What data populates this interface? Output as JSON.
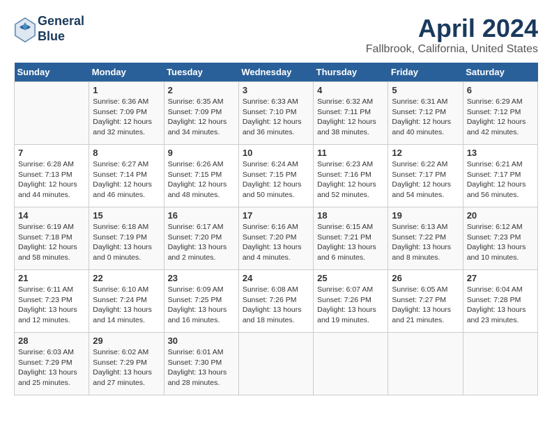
{
  "header": {
    "logo_line1": "General",
    "logo_line2": "Blue",
    "title": "April 2024",
    "subtitle": "Fallbrook, California, United States"
  },
  "days_of_week": [
    "Sunday",
    "Monday",
    "Tuesday",
    "Wednesday",
    "Thursday",
    "Friday",
    "Saturday"
  ],
  "weeks": [
    [
      {
        "day": "",
        "sunrise": "",
        "sunset": "",
        "daylight": ""
      },
      {
        "day": "1",
        "sunrise": "Sunrise: 6:36 AM",
        "sunset": "Sunset: 7:09 PM",
        "daylight": "Daylight: 12 hours and 32 minutes."
      },
      {
        "day": "2",
        "sunrise": "Sunrise: 6:35 AM",
        "sunset": "Sunset: 7:09 PM",
        "daylight": "Daylight: 12 hours and 34 minutes."
      },
      {
        "day": "3",
        "sunrise": "Sunrise: 6:33 AM",
        "sunset": "Sunset: 7:10 PM",
        "daylight": "Daylight: 12 hours and 36 minutes."
      },
      {
        "day": "4",
        "sunrise": "Sunrise: 6:32 AM",
        "sunset": "Sunset: 7:11 PM",
        "daylight": "Daylight: 12 hours and 38 minutes."
      },
      {
        "day": "5",
        "sunrise": "Sunrise: 6:31 AM",
        "sunset": "Sunset: 7:12 PM",
        "daylight": "Daylight: 12 hours and 40 minutes."
      },
      {
        "day": "6",
        "sunrise": "Sunrise: 6:29 AM",
        "sunset": "Sunset: 7:12 PM",
        "daylight": "Daylight: 12 hours and 42 minutes."
      }
    ],
    [
      {
        "day": "7",
        "sunrise": "Sunrise: 6:28 AM",
        "sunset": "Sunset: 7:13 PM",
        "daylight": "Daylight: 12 hours and 44 minutes."
      },
      {
        "day": "8",
        "sunrise": "Sunrise: 6:27 AM",
        "sunset": "Sunset: 7:14 PM",
        "daylight": "Daylight: 12 hours and 46 minutes."
      },
      {
        "day": "9",
        "sunrise": "Sunrise: 6:26 AM",
        "sunset": "Sunset: 7:15 PM",
        "daylight": "Daylight: 12 hours and 48 minutes."
      },
      {
        "day": "10",
        "sunrise": "Sunrise: 6:24 AM",
        "sunset": "Sunset: 7:15 PM",
        "daylight": "Daylight: 12 hours and 50 minutes."
      },
      {
        "day": "11",
        "sunrise": "Sunrise: 6:23 AM",
        "sunset": "Sunset: 7:16 PM",
        "daylight": "Daylight: 12 hours and 52 minutes."
      },
      {
        "day": "12",
        "sunrise": "Sunrise: 6:22 AM",
        "sunset": "Sunset: 7:17 PM",
        "daylight": "Daylight: 12 hours and 54 minutes."
      },
      {
        "day": "13",
        "sunrise": "Sunrise: 6:21 AM",
        "sunset": "Sunset: 7:17 PM",
        "daylight": "Daylight: 12 hours and 56 minutes."
      }
    ],
    [
      {
        "day": "14",
        "sunrise": "Sunrise: 6:19 AM",
        "sunset": "Sunset: 7:18 PM",
        "daylight": "Daylight: 12 hours and 58 minutes."
      },
      {
        "day": "15",
        "sunrise": "Sunrise: 6:18 AM",
        "sunset": "Sunset: 7:19 PM",
        "daylight": "Daylight: 13 hours and 0 minutes."
      },
      {
        "day": "16",
        "sunrise": "Sunrise: 6:17 AM",
        "sunset": "Sunset: 7:20 PM",
        "daylight": "Daylight: 13 hours and 2 minutes."
      },
      {
        "day": "17",
        "sunrise": "Sunrise: 6:16 AM",
        "sunset": "Sunset: 7:20 PM",
        "daylight": "Daylight: 13 hours and 4 minutes."
      },
      {
        "day": "18",
        "sunrise": "Sunrise: 6:15 AM",
        "sunset": "Sunset: 7:21 PM",
        "daylight": "Daylight: 13 hours and 6 minutes."
      },
      {
        "day": "19",
        "sunrise": "Sunrise: 6:13 AM",
        "sunset": "Sunset: 7:22 PM",
        "daylight": "Daylight: 13 hours and 8 minutes."
      },
      {
        "day": "20",
        "sunrise": "Sunrise: 6:12 AM",
        "sunset": "Sunset: 7:23 PM",
        "daylight": "Daylight: 13 hours and 10 minutes."
      }
    ],
    [
      {
        "day": "21",
        "sunrise": "Sunrise: 6:11 AM",
        "sunset": "Sunset: 7:23 PM",
        "daylight": "Daylight: 13 hours and 12 minutes."
      },
      {
        "day": "22",
        "sunrise": "Sunrise: 6:10 AM",
        "sunset": "Sunset: 7:24 PM",
        "daylight": "Daylight: 13 hours and 14 minutes."
      },
      {
        "day": "23",
        "sunrise": "Sunrise: 6:09 AM",
        "sunset": "Sunset: 7:25 PM",
        "daylight": "Daylight: 13 hours and 16 minutes."
      },
      {
        "day": "24",
        "sunrise": "Sunrise: 6:08 AM",
        "sunset": "Sunset: 7:26 PM",
        "daylight": "Daylight: 13 hours and 18 minutes."
      },
      {
        "day": "25",
        "sunrise": "Sunrise: 6:07 AM",
        "sunset": "Sunset: 7:26 PM",
        "daylight": "Daylight: 13 hours and 19 minutes."
      },
      {
        "day": "26",
        "sunrise": "Sunrise: 6:05 AM",
        "sunset": "Sunset: 7:27 PM",
        "daylight": "Daylight: 13 hours and 21 minutes."
      },
      {
        "day": "27",
        "sunrise": "Sunrise: 6:04 AM",
        "sunset": "Sunset: 7:28 PM",
        "daylight": "Daylight: 13 hours and 23 minutes."
      }
    ],
    [
      {
        "day": "28",
        "sunrise": "Sunrise: 6:03 AM",
        "sunset": "Sunset: 7:29 PM",
        "daylight": "Daylight: 13 hours and 25 minutes."
      },
      {
        "day": "29",
        "sunrise": "Sunrise: 6:02 AM",
        "sunset": "Sunset: 7:29 PM",
        "daylight": "Daylight: 13 hours and 27 minutes."
      },
      {
        "day": "30",
        "sunrise": "Sunrise: 6:01 AM",
        "sunset": "Sunset: 7:30 PM",
        "daylight": "Daylight: 13 hours and 28 minutes."
      },
      {
        "day": "",
        "sunrise": "",
        "sunset": "",
        "daylight": ""
      },
      {
        "day": "",
        "sunrise": "",
        "sunset": "",
        "daylight": ""
      },
      {
        "day": "",
        "sunrise": "",
        "sunset": "",
        "daylight": ""
      },
      {
        "day": "",
        "sunrise": "",
        "sunset": "",
        "daylight": ""
      }
    ]
  ]
}
